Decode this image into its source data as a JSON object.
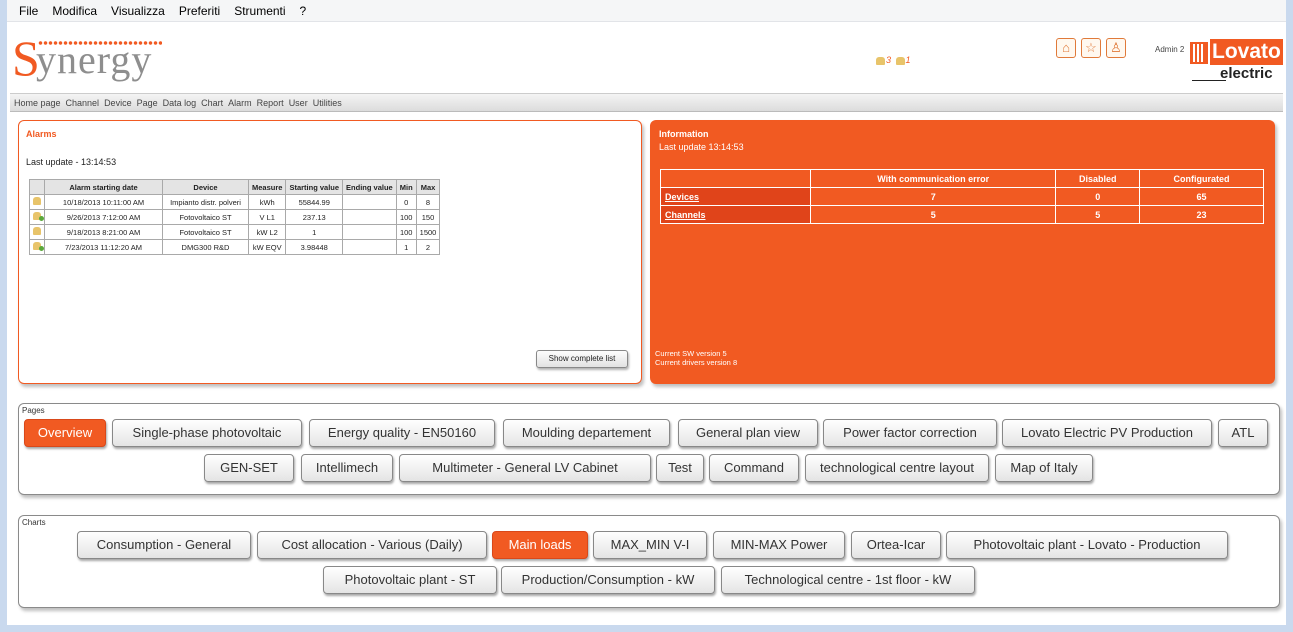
{
  "menubar": {
    "items": [
      "File",
      "Modifica",
      "Visualizza",
      "Preferiti",
      "Strumenti",
      "?"
    ]
  },
  "header": {
    "logo_initial": "S",
    "logo_rest": "ynergy",
    "alarm_counts": [
      "3",
      "1"
    ],
    "user": "Admin 2",
    "brand_word": "Lovato",
    "brand_sub": "electric",
    "icons": [
      "home-icon",
      "star-icon",
      "user-icon"
    ]
  },
  "nav": {
    "items": [
      "Home page",
      "Channel",
      "Device",
      "Page",
      "Data log",
      "Chart",
      "Alarm",
      "Report",
      "User",
      "Utilities"
    ]
  },
  "alarms": {
    "title": "Alarms",
    "last_update": "Last update - 13:14:53",
    "columns": [
      "",
      "Alarm starting date",
      "Device",
      "Measure",
      "Starting value",
      "Ending value",
      "Min",
      "Max"
    ],
    "rows": [
      [
        "",
        "10/18/2013 10:11:00 AM",
        "Impianto distr. polveri",
        "kWh",
        "55844.99",
        "",
        "0",
        "8"
      ],
      [
        "",
        "9/26/2013 7:12:00 AM",
        "Fotovoltaico ST",
        "V L1",
        "237.13",
        "",
        "100",
        "150"
      ],
      [
        "",
        "9/18/2013 8:21:00 AM",
        "Fotovoltaico ST",
        "kW L2",
        "1",
        "",
        "100",
        "1500"
      ],
      [
        "",
        "7/23/2013 11:12:20 AM",
        "DMG300 R&D",
        "kW EQV",
        "3.98448",
        "",
        "1",
        "2"
      ]
    ],
    "show_complete": "Show complete list"
  },
  "information": {
    "title": "Information",
    "last_update": "Last update  13:14:53",
    "columns": [
      "",
      "With communication error",
      "Disabled",
      "Configurated"
    ],
    "rows": [
      [
        "Devices",
        "7",
        "0",
        "65"
      ],
      [
        "Channels",
        "5",
        "5",
        "23"
      ]
    ],
    "sw_version": "Current SW version 5",
    "drivers_version": "Current drivers version 8"
  },
  "pages": {
    "label": "Pages",
    "buttons": [
      "Overview",
      "Single-phase photovoltaic",
      "Energy quality - EN50160",
      "Moulding departement",
      "General plan view",
      "Power factor correction",
      "Lovato Electric PV Production",
      "ATL",
      "GEN-SET",
      "Intellimech",
      "Multimeter - General LV Cabinet",
      "Test",
      "Command",
      "technological centre layout",
      "Map of Italy"
    ],
    "active": "Overview"
  },
  "charts": {
    "label": "Charts",
    "buttons": [
      "Consumption - General",
      "Cost allocation -  Various (Daily)",
      "Main loads",
      "MAX_MIN V-I",
      "MIN-MAX Power",
      "Ortea-Icar",
      "Photovoltaic plant - Lovato - Production",
      "Photovoltaic plant - ST",
      "Production/Consumption - kW",
      "Technological centre - 1st floor - kW"
    ],
    "active": "Main loads"
  },
  "colors": {
    "accent": "#f15a22",
    "frame": "#c9d9ee"
  }
}
